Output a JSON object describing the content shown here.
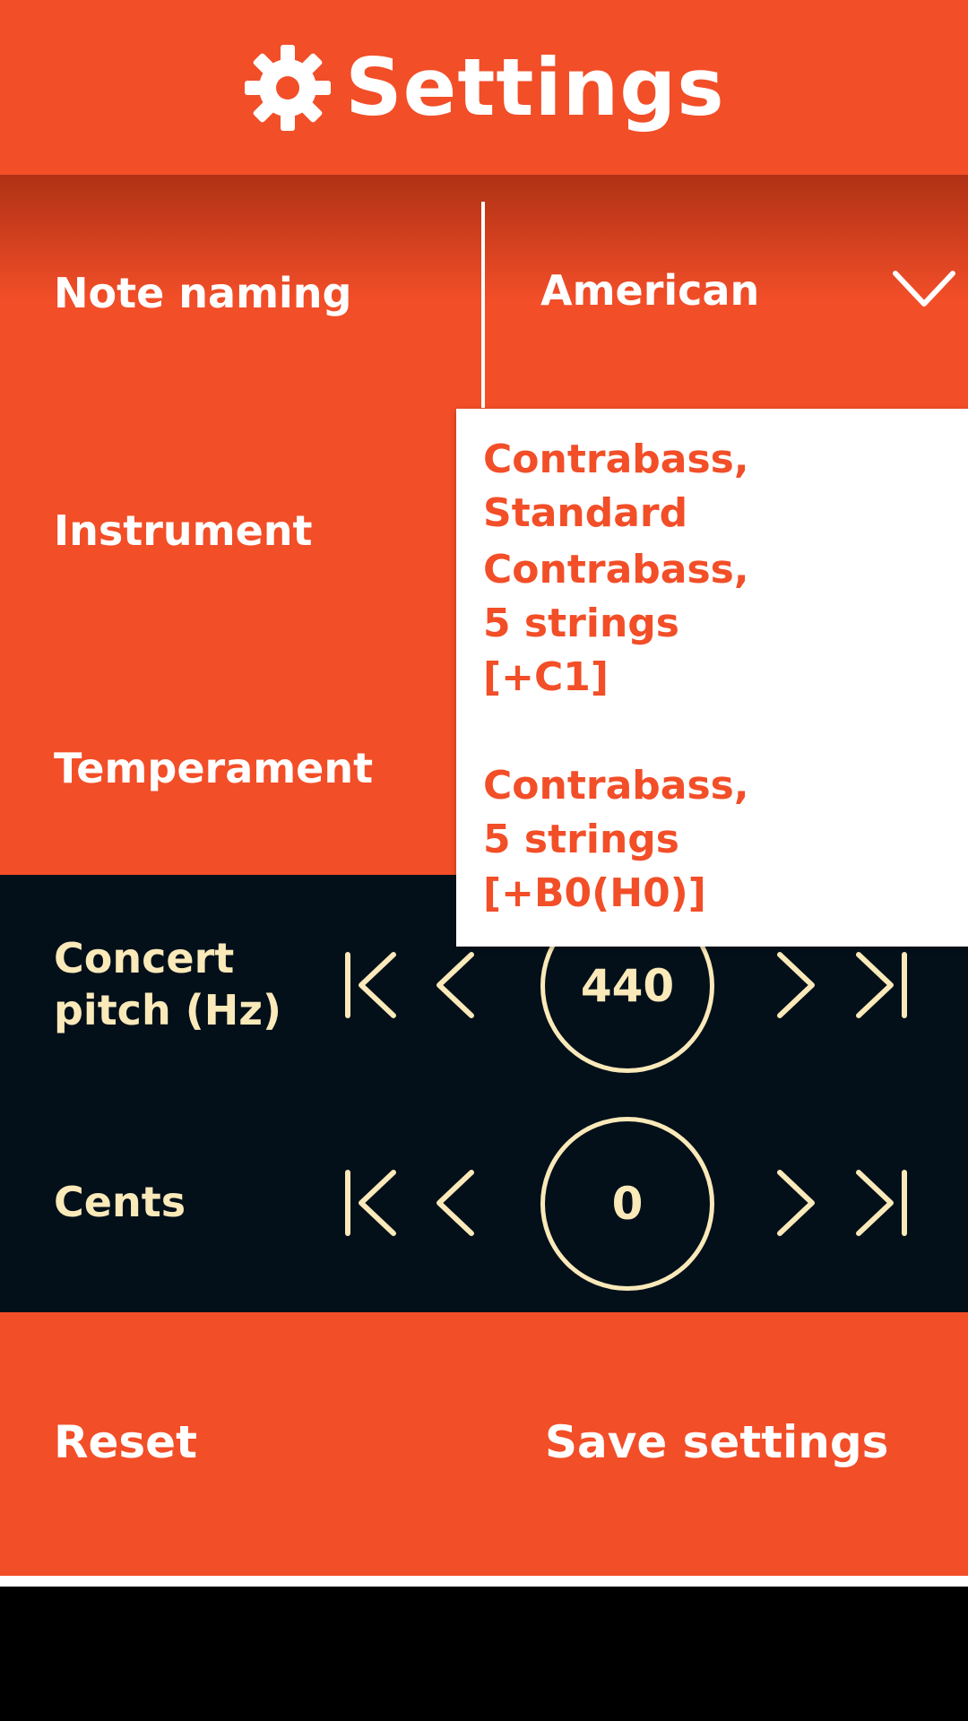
{
  "header": {
    "title": "Settings",
    "icon": "gear-icon"
  },
  "settings": {
    "note_naming": {
      "label": "Note naming",
      "value": "American"
    },
    "instrument": {
      "label": "Instrument"
    },
    "temperament": {
      "label": "Temperament"
    }
  },
  "instrument_dropdown": {
    "options": [
      {
        "label": "Contrabass, Standard"
      },
      {
        "label": "Contrabass,\n5 strings\n[+C1]"
      },
      {
        "label": "Contrabass,\n5 strings\n[+B0(H0)]"
      }
    ]
  },
  "tuning": {
    "concert_pitch": {
      "label": "Concert\npitch (Hz)",
      "value": "440"
    },
    "cents": {
      "label": "Cents",
      "value": "0"
    }
  },
  "actions": {
    "reset_label": "Reset",
    "save_label": "Save settings"
  },
  "colors": {
    "accent": "#F24E28",
    "dark_panel": "#03101A",
    "cream": "#FAE9B9",
    "white": "#FFFFFF"
  }
}
